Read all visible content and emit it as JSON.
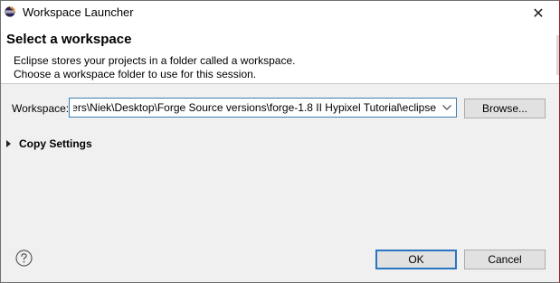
{
  "window": {
    "title": "Workspace Launcher",
    "close_glyph": "✕",
    "app_icon": "eclipse-icon"
  },
  "banner": {
    "title": "Select a workspace",
    "description_line1": "Eclipse stores your projects in a folder called a workspace.",
    "description_line2": "Choose a workspace folder to use for this session."
  },
  "workspace": {
    "label": "Workspace:",
    "value": "ers\\Niek\\Desktop\\Forge Source versions\\forge-1.8 II Hypixel Tutorial\\eclipse",
    "dropdown_icon": "chevron-down-icon",
    "browse_label": "Browse..."
  },
  "copy_settings": {
    "label": "Copy Settings",
    "expanded": false
  },
  "footer": {
    "help_icon": "help-icon",
    "ok_label": "OK",
    "cancel_label": "Cancel"
  },
  "colors": {
    "accent_border": "#2a74c4",
    "combo_border": "#3c7fb1",
    "dialog_bg": "#f0f0f0"
  }
}
